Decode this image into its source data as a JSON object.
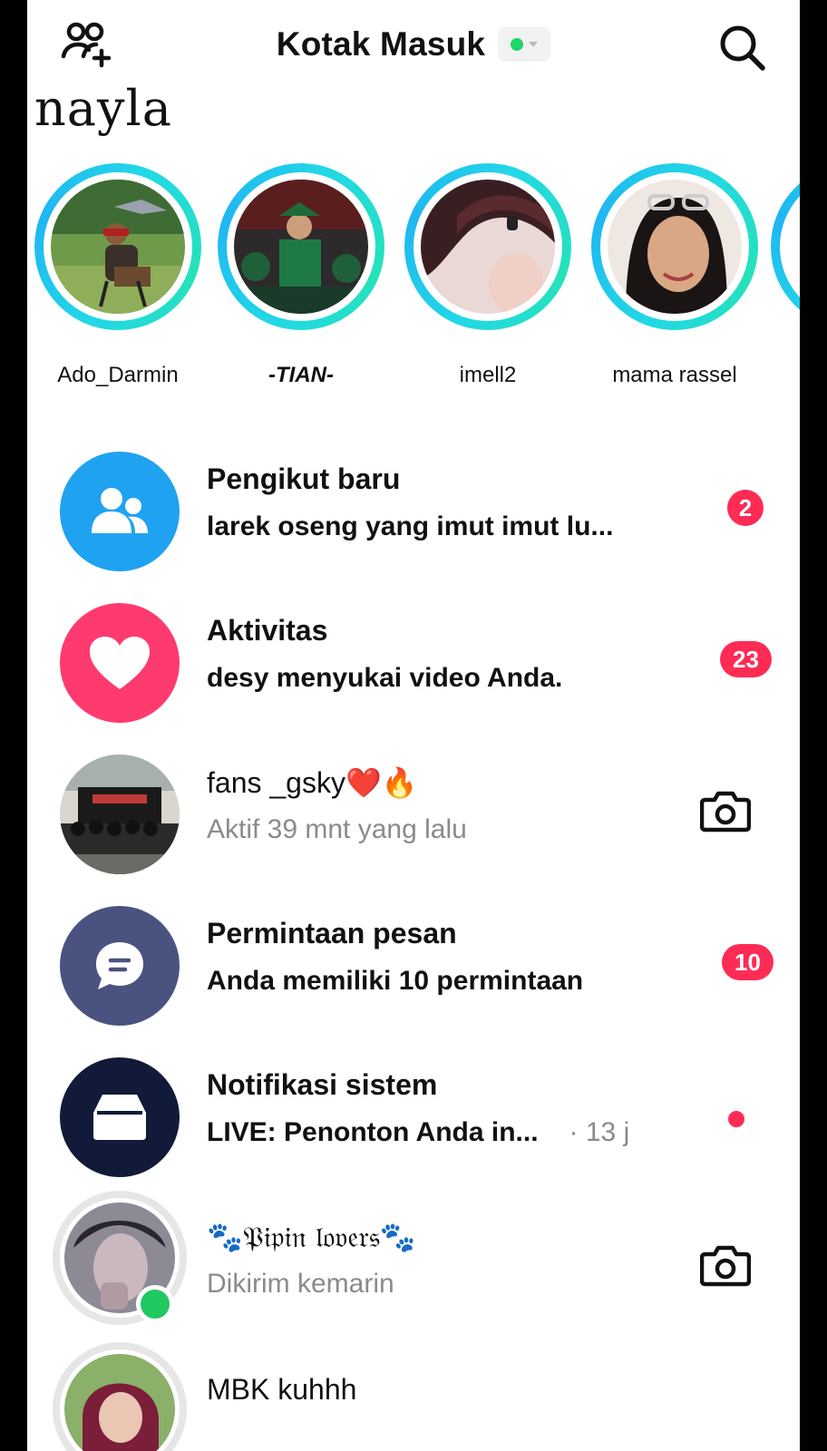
{
  "header": {
    "title": "Kotak Masuk",
    "user_name": "nayla",
    "status_color": "#20d56b",
    "add_friend_icon": "add-friends-icon",
    "search_icon": "search-icon"
  },
  "stories": [
    {
      "name": "Ado_Darmin"
    },
    {
      "name": "-TIAN-"
    },
    {
      "name": "imell2"
    },
    {
      "name": "mama rassel"
    }
  ],
  "inbox": {
    "new_followers": {
      "title": "Pengikut baru",
      "subtitle": "larek oseng yang imut imut lu...",
      "count": "2",
      "icon": "users-icon",
      "color": "#1fa2f0"
    },
    "activity": {
      "title": "Aktivitas",
      "subtitle": "desy menyukai video Anda.",
      "count": "23",
      "icon": "heart-icon",
      "color": "#fe3a6e"
    },
    "fans": {
      "title": "fans _gsky❤️🔥",
      "subtitle": "Aktif 39 mnt yang lalu",
      "icon": "camera-icon"
    },
    "message_requests": {
      "title": "Permintaan pesan",
      "subtitle": "Anda memiliki 10 permintaan",
      "count": "10",
      "icon": "chat-icon",
      "color": "#4a5280"
    },
    "system": {
      "title": "Notifikasi sistem",
      "subtitle": "LIVE: Penonton Anda in...",
      "time": "· 13 j",
      "icon": "inbox-icon",
      "color": "#121a3a"
    },
    "pipin": {
      "title": "🐾𝔓𝔦𝔭𝔦𝔫 𝔩𝔬𝔳𝔢𝔯𝔰🐾",
      "subtitle": "Dikirim kemarin",
      "icon": "camera-icon"
    },
    "mbk": {
      "title": "MBK kuhhh"
    }
  },
  "badge_color": "#fe2c55"
}
